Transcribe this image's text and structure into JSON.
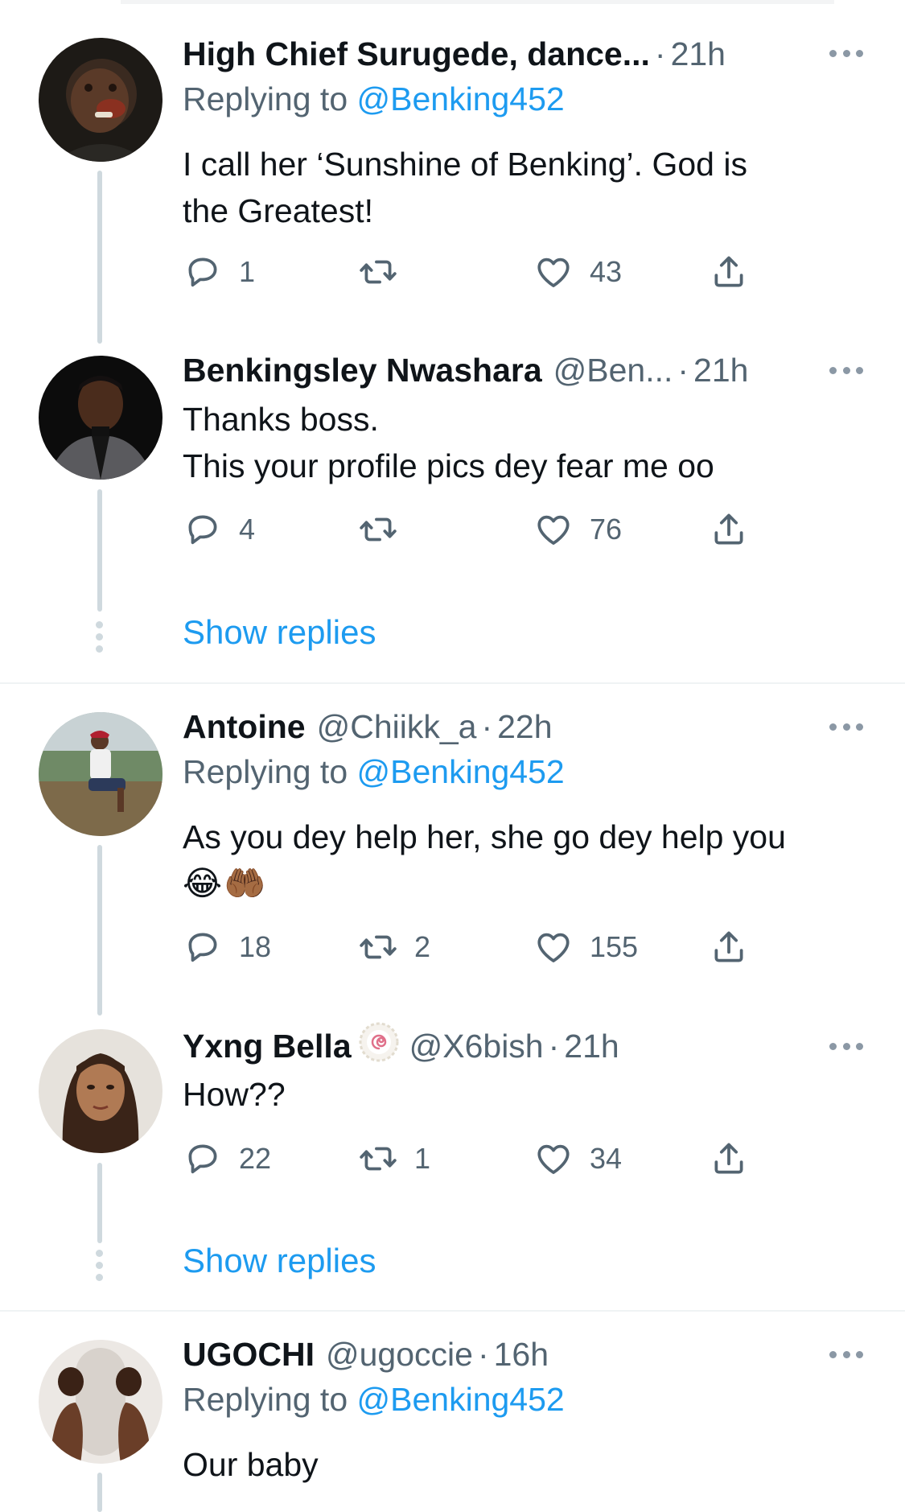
{
  "tweets": [
    {
      "name": "High Chief Surugede, dance...",
      "handle": "",
      "time": "21h",
      "replying_prefix": "Replying to ",
      "replying_to": "@Benking452",
      "text": [
        "I call her ‘Sunshine of Benking’. God is",
        "the Greatest!"
      ],
      "counts": {
        "reply": "1",
        "retweet": "",
        "like": "43"
      }
    },
    {
      "name": "Benkingsley Nwashara",
      "handle": "@Ben...",
      "time": "21h",
      "text": [
        "Thanks boss.",
        "This your profile pics dey fear me oo"
      ],
      "counts": {
        "reply": "4",
        "retweet": "",
        "like": "76"
      }
    },
    {
      "name": "Antoine",
      "handle": "@Chiikk_a",
      "time": "22h",
      "replying_prefix": "Replying to ",
      "replying_to": "@Benking452",
      "text": [
        "As you dey help her, she go dey help you"
      ],
      "emoji": "😂🤲🏾",
      "counts": {
        "reply": "18",
        "retweet": "2",
        "like": "155"
      }
    },
    {
      "name": "Yxng Bella",
      "handle": "@X6bish",
      "time": "21h",
      "text": [
        "How??"
      ],
      "counts": {
        "reply": "22",
        "retweet": "1",
        "like": "34"
      }
    },
    {
      "name": "UGOCHI",
      "handle": "@ugoccie",
      "time": "16h",
      "replying_prefix": "Replying to ",
      "replying_to": "@Benking452",
      "text": [
        "Our baby"
      ]
    }
  ],
  "show_replies_label": "Show replies",
  "separator_dot": "·",
  "icons": {
    "reply": "reply-bubble-icon",
    "retweet": "retweet-icon",
    "like": "heart-icon",
    "share": "share-upload-icon",
    "more": "more-dots-icon",
    "verified": "swirl-badge-icon"
  },
  "colors": {
    "accent": "#1d9bf0",
    "text": "#0f1419",
    "secondary": "#536471",
    "thread_line": "#cfd9de",
    "divider": "#eff3f4"
  }
}
